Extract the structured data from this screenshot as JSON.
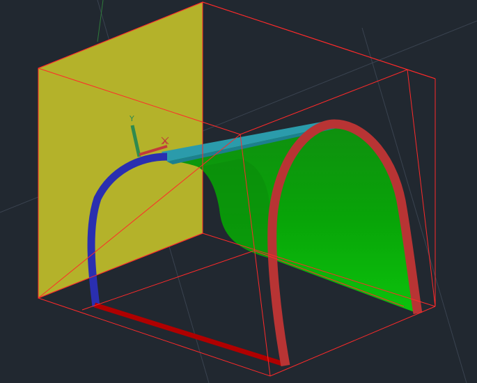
{
  "viewport": {
    "background": "#212830"
  },
  "ucs_icon": {
    "y_axis_label": "Y",
    "x_axis_label": "X",
    "y_axis_color": "#2f8a4e",
    "x_axis_color": "#c23a3a"
  },
  "colors": {
    "back_plane": "#b4b22a",
    "bounding_box": "#ff2a2a",
    "surface_green": "#0d9c0d",
    "surface_cyan": "#2b9bab",
    "arch_front": "#b83434",
    "arch_back": "#2a2fb0",
    "bottom_edge": "#b00000",
    "guide_lines": "#3c4552"
  },
  "icons": [
    "ucs-icon",
    "crosshair-cursor-icon"
  ]
}
